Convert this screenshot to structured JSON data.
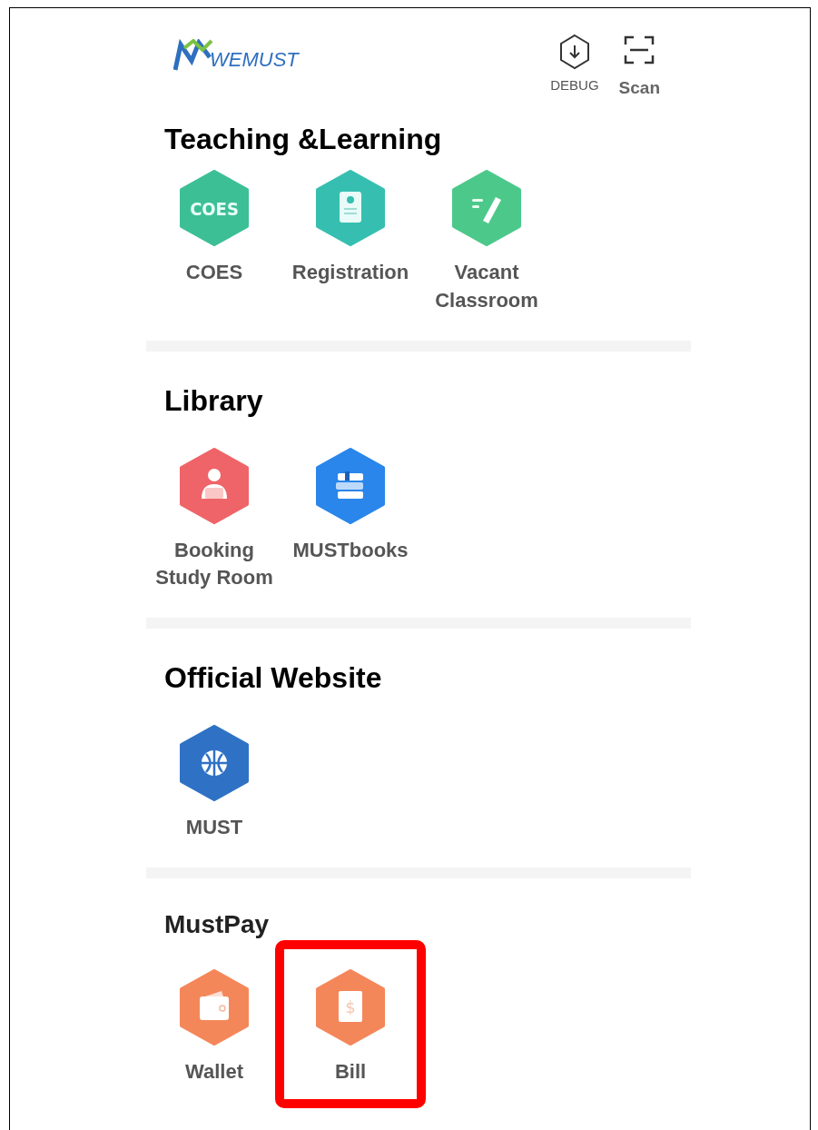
{
  "header": {
    "logo_text": "WEMUST",
    "actions": [
      {
        "kind": "debug",
        "label": "DEBUG"
      },
      {
        "kind": "scan",
        "label": "Scan"
      }
    ]
  },
  "sections": [
    {
      "title": "Teaching &Learning",
      "apps": [
        {
          "label": "COES",
          "icon_text": "COES",
          "color": "#3dbf95",
          "highlighted": false
        },
        {
          "label": "Registration",
          "color": "#36bfb0",
          "highlighted": false
        },
        {
          "label": "Vacant Classroom",
          "color": "#4cc98a",
          "highlighted": false
        }
      ]
    },
    {
      "title": "Library",
      "apps": [
        {
          "label": "Booking Study Room",
          "color": "#ee6468",
          "highlighted": false
        },
        {
          "label": "MUSTbooks",
          "color": "#2a86ea",
          "highlighted": false
        }
      ]
    },
    {
      "title": "Official Website",
      "apps": [
        {
          "label": "MUST",
          "color": "#2f72c5",
          "highlighted": false
        }
      ]
    },
    {
      "title": "MustPay",
      "apps": [
        {
          "label": "Wallet",
          "color": "#f4875a",
          "highlighted": false
        },
        {
          "label": "Bill",
          "icon_text": "$",
          "color": "#f4875a",
          "highlighted": true
        }
      ]
    }
  ]
}
